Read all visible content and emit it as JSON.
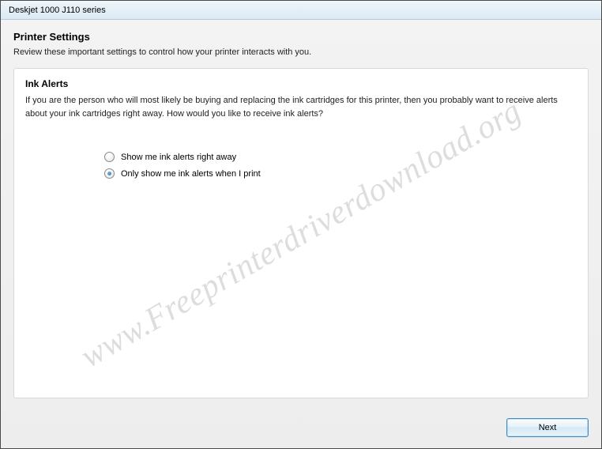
{
  "window": {
    "title": "Deskjet 1000 J110 series"
  },
  "page": {
    "title": "Printer Settings",
    "subtitle": "Review these important settings to control how your printer interacts with you."
  },
  "panel": {
    "title": "Ink Alerts",
    "description": "If you are the person who will most likely be buying and replacing the ink cartridges for this printer, then you probably want to receive alerts about your ink cartridges right away. How would you like to receive ink alerts?"
  },
  "options": {
    "opt1": "Show me ink alerts right away",
    "opt2": "Only show me ink alerts when I print",
    "selected": "opt2"
  },
  "buttons": {
    "next": "Next"
  },
  "watermark": "www.Freeprinterdriverdownload.org"
}
